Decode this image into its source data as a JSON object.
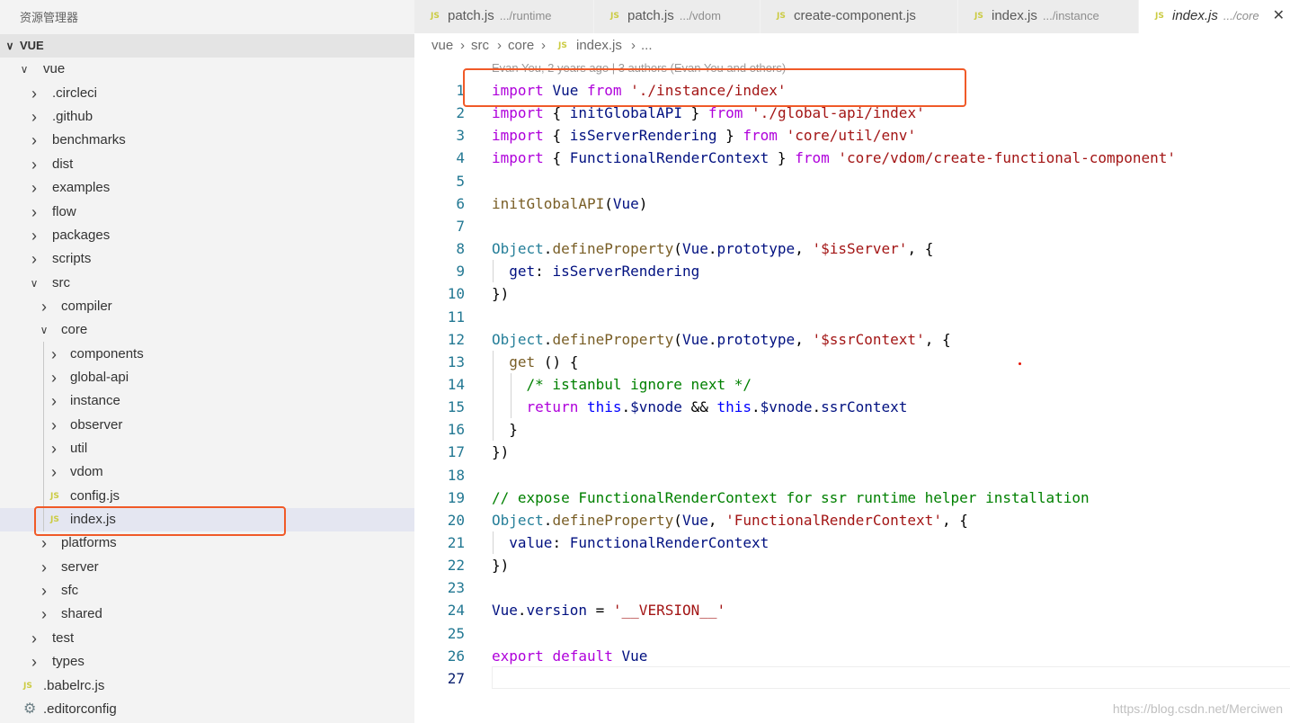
{
  "sidebar": {
    "title": "资源管理器",
    "root_label": "VUE",
    "items": [
      {
        "label": "vue",
        "kind": "folder",
        "expanded": true
      },
      {
        "label": ".circleci",
        "kind": "folder",
        "expanded": false
      },
      {
        "label": ".github",
        "kind": "folder",
        "expanded": false
      },
      {
        "label": "benchmarks",
        "kind": "folder",
        "expanded": false
      },
      {
        "label": "dist",
        "kind": "folder",
        "expanded": false
      },
      {
        "label": "examples",
        "kind": "folder",
        "expanded": false
      },
      {
        "label": "flow",
        "kind": "folder",
        "expanded": false
      },
      {
        "label": "packages",
        "kind": "folder",
        "expanded": false
      },
      {
        "label": "scripts",
        "kind": "folder",
        "expanded": false
      },
      {
        "label": "src",
        "kind": "folder",
        "expanded": true
      },
      {
        "label": "compiler",
        "kind": "folder",
        "expanded": false
      },
      {
        "label": "core",
        "kind": "folder",
        "expanded": true
      },
      {
        "label": "components",
        "kind": "folder",
        "expanded": false
      },
      {
        "label": "global-api",
        "kind": "folder",
        "expanded": false
      },
      {
        "label": "instance",
        "kind": "folder",
        "expanded": false
      },
      {
        "label": "observer",
        "kind": "folder",
        "expanded": false
      },
      {
        "label": "util",
        "kind": "folder",
        "expanded": false
      },
      {
        "label": "vdom",
        "kind": "folder",
        "expanded": false
      },
      {
        "label": "config.js",
        "kind": "js-file"
      },
      {
        "label": "index.js",
        "kind": "js-file",
        "selected": true
      },
      {
        "label": "platforms",
        "kind": "folder",
        "expanded": false
      },
      {
        "label": "server",
        "kind": "folder",
        "expanded": false
      },
      {
        "label": "sfc",
        "kind": "folder",
        "expanded": false
      },
      {
        "label": "shared",
        "kind": "folder",
        "expanded": false
      },
      {
        "label": "test",
        "kind": "folder",
        "expanded": false
      },
      {
        "label": "types",
        "kind": "folder",
        "expanded": false
      },
      {
        "label": ".babelrc.js",
        "kind": "js-file"
      },
      {
        "label": ".editorconfig",
        "kind": "config-file"
      }
    ]
  },
  "tabs": [
    {
      "label": "patch.js",
      "description": ".../runtime",
      "icon": "JS"
    },
    {
      "label": "patch.js",
      "description": ".../vdom",
      "icon": "JS"
    },
    {
      "label": "create-component.js",
      "description": "",
      "icon": "JS"
    },
    {
      "label": "index.js",
      "description": ".../instance",
      "icon": "JS"
    },
    {
      "label": "index.js",
      "description": ".../core",
      "icon": "JS",
      "active": true
    }
  ],
  "breadcrumb": {
    "items": [
      "vue",
      "src",
      "core",
      "index.js",
      "..."
    ],
    "separator": "›",
    "file_icon": "JS"
  },
  "editor": {
    "codelens": "Evan You, 2 years ago | 3 authors (Evan You and others)",
    "line_numbers": [
      "1",
      "2",
      "3",
      "4",
      "5",
      "6",
      "7",
      "8",
      "9",
      "10",
      "11",
      "12",
      "13",
      "14",
      "15",
      "16",
      "17",
      "18",
      "19",
      "20",
      "21",
      "22",
      "23",
      "24",
      "25",
      "26",
      "27"
    ],
    "lines": [
      "import Vue from './instance/index'",
      "import { initGlobalAPI } from './global-api/index'",
      "import { isServerRendering } from 'core/util/env'",
      "import { FunctionalRenderContext } from 'core/vdom/create-functional-component'",
      "",
      "initGlobalAPI(Vue)",
      "",
      "Object.defineProperty(Vue.prototype, '$isServer', {",
      "  get: isServerRendering",
      "})",
      "",
      "Object.defineProperty(Vue.prototype, '$ssrContext', {",
      "  get () {",
      "    /* istanbul ignore next */",
      "    return this.$vnode && this.$vnode.ssrContext",
      "  }",
      "})",
      "",
      "// expose FunctionalRenderContext for ssr runtime helper installation",
      "Object.defineProperty(Vue, 'FunctionalRenderContext', {",
      "  value: FunctionalRenderContext",
      "})",
      "",
      "Vue.version = '__VERSION__'",
      "",
      "export default Vue",
      ""
    ],
    "current_line": 27
  },
  "watermark": "https://blog.csdn.net/Merciwen",
  "colors": {
    "annotation_box": "#f05a28",
    "sidebar_bg": "#f3f3f3",
    "selected_row": "#e4e6f1",
    "keyword": "#af00db",
    "string": "#a31515",
    "function": "#795e26",
    "comment": "#008000",
    "line_number": "#237893"
  }
}
